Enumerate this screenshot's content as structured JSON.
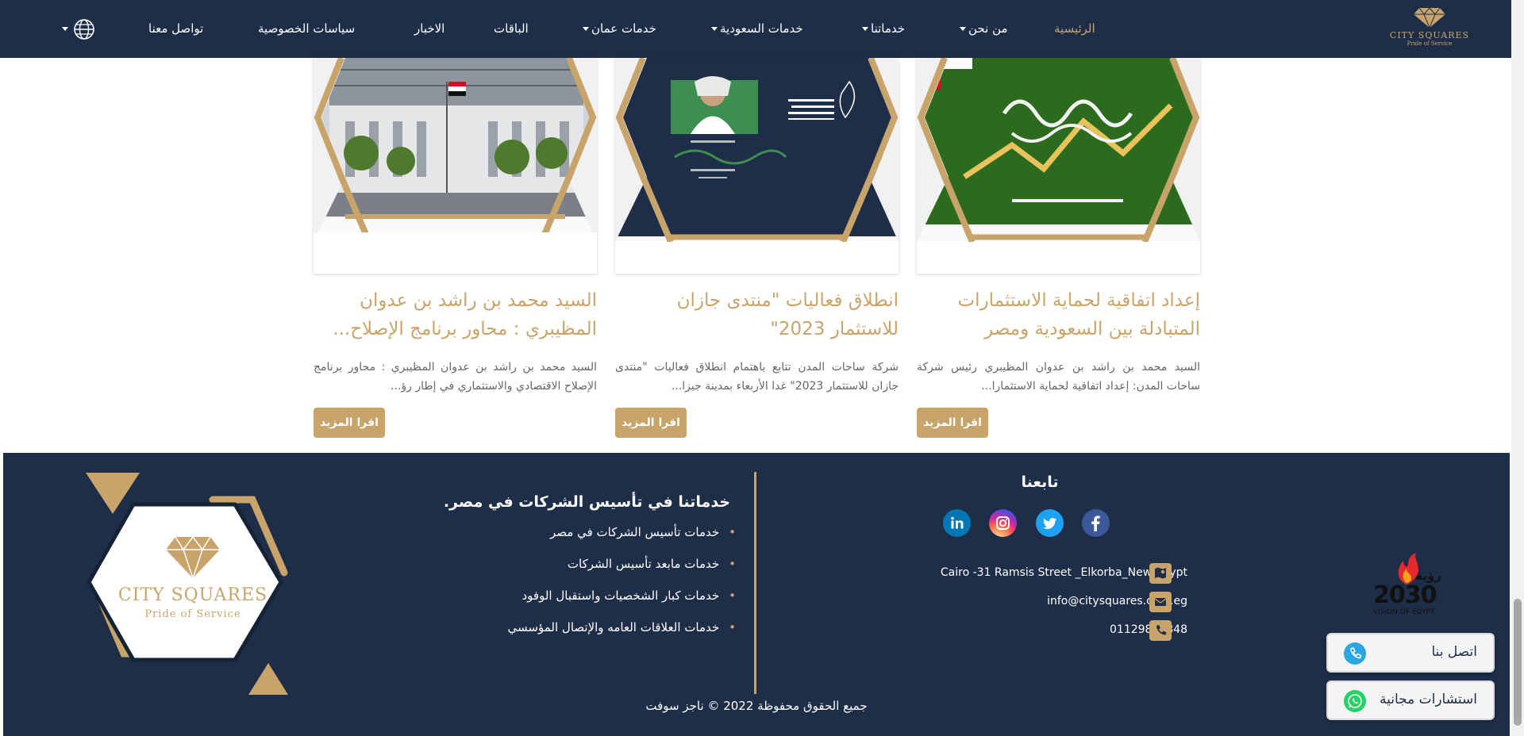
{
  "nav": {
    "brand_name": "CITY SQUARES",
    "brand_tagline": "Pride of Service",
    "items": [
      {
        "label": "الرئيسية"
      },
      {
        "label": "من نحن"
      },
      {
        "label": "خدماتنا"
      },
      {
        "label": "خدمات السعودية"
      },
      {
        "label": "خدمات عمان"
      },
      {
        "label": "الباقات"
      },
      {
        "label": "الاخبار"
      },
      {
        "label": "سياسات الخصوصية"
      },
      {
        "label": "تواصل معنا"
      }
    ],
    "active_item": "الرئيسية"
  },
  "news": [
    {
      "title": "إعداد اتفاقية لحماية الاستثمارات المتبادلة بين السعودية ومصر",
      "excerpt": "السيد محمد بن راشد بن عدوان المظيبري رئيس شركة ساحات المدن: إعداد اتفاقية لحماية الاستثمارا...",
      "button": "اقرا المزيد"
    },
    {
      "title": "انطلاق فعاليات \"منتدى جازان للاستثمار 2023\"",
      "excerpt": "شركة ساحات المدن تتابع باهتمام انطلاق فعاليات \"منتدى جازان للاستثمار 2023\" غدا الأربعاء بمدينة جيزا...",
      "button": "اقرا المزيد"
    },
    {
      "title": "السيد محمد بن راشد بن عدوان المظيبري : محاور برنامج الإصلاح...",
      "excerpt": "السيد محمد بن راشد بن عدوان المظيبري : محاور برنامج الإصلاح الاقتصادي والاستثماري في إطار رؤ...",
      "button": "اقرا المزيد"
    }
  ],
  "footer": {
    "follow_title": "تابعنا",
    "social": [
      {
        "icon": "facebook-icon",
        "color": "#3b5998"
      },
      {
        "icon": "twitter-icon",
        "color": "#1da1f2"
      },
      {
        "icon": "instagram-icon",
        "color": "#e1306c"
      },
      {
        "icon": "linkedin-icon",
        "color": "#0077b5"
      }
    ],
    "address": "Cairo -31 Ramsis Street _Elkorba_New Egypt",
    "email": "info@citysquares.com.eg",
    "phone": "01129856848",
    "services_title": "خدماتنا في تأسيس الشركات في مصر.",
    "services": [
      "خدمات تأسيس الشركات في مصر",
      "خدمات مابعد تأسيس الشركات",
      "خدمات كبار الشخصيات واستقبال الوفود",
      "خدمات العلاقات العامه والإتصال المؤسسي"
    ],
    "logo_name": "CITY SQUARES",
    "logo_tagline": "Pride of Service",
    "vision_arabic": "رؤية",
    "vision_number": "2030",
    "vision_caption": "VISION OF EGYPT",
    "copyright": "جميع الحقوق محفوظة 2022 © ناجز سوفت"
  },
  "floating": {
    "call_label": "اتصل بنا",
    "consult_label": "استشارات مجانية"
  },
  "colors": {
    "navy": "#1f2e48",
    "gold": "#c8a46a"
  }
}
